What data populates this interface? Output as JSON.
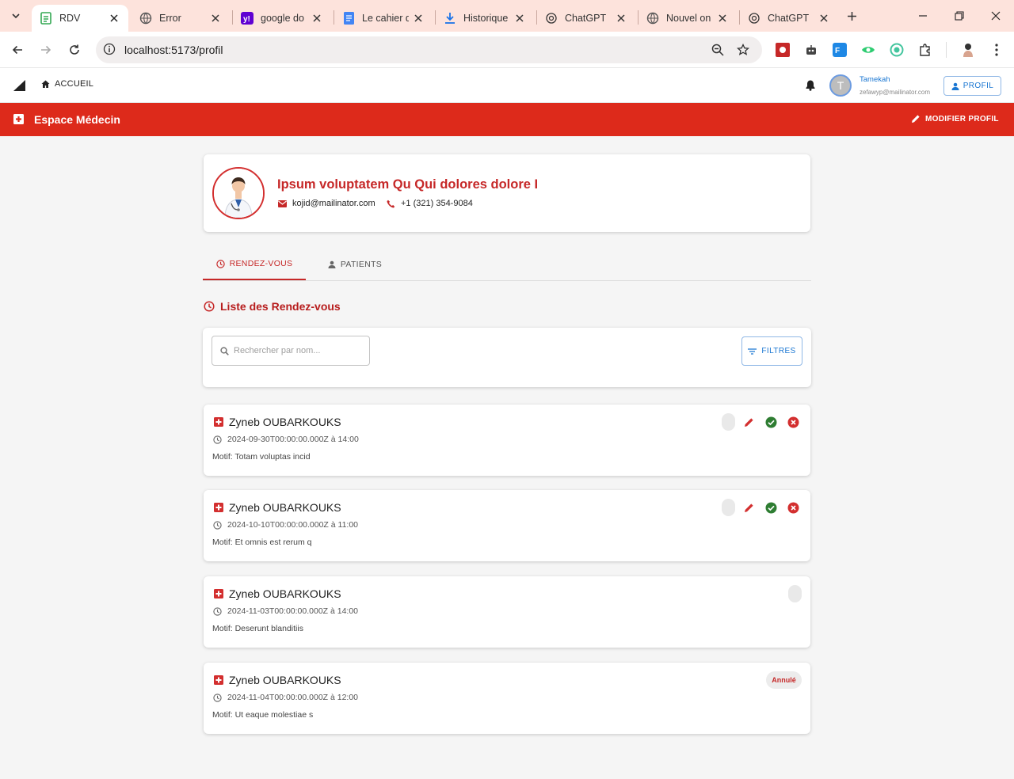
{
  "browser": {
    "tabs": [
      {
        "title": "RDV",
        "favicon": "rdv-doc-icon",
        "active": true
      },
      {
        "title": "Error",
        "favicon": "globe-icon"
      },
      {
        "title": "google do",
        "favicon": "yahoo-icon"
      },
      {
        "title": "Le cahier d",
        "favicon": "docs-icon"
      },
      {
        "title": "Historique",
        "favicon": "download-icon"
      },
      {
        "title": "ChatGPT",
        "favicon": "chatgpt-icon"
      },
      {
        "title": "Nouvel on",
        "favicon": "globe-icon"
      },
      {
        "title": "ChatGPT",
        "favicon": "chatgpt-icon"
      }
    ],
    "url": "localhost:5173/profil"
  },
  "appbar": {
    "home_label": "ACCUEIL",
    "user_initial": "T",
    "user_name": "Tamekah",
    "user_email": "zefawyp@mailinator.com",
    "profile_button": "PROFIL"
  },
  "banner": {
    "title": "Espace Médecin",
    "edit_button": "MODIFIER PROFIL",
    "color": "#dd2a1b"
  },
  "profile": {
    "name": "Ipsum voluptatem Qu Qui dolores dolore I",
    "email": "kojid@mailinator.com",
    "phone": "+1 (321) 354-9084"
  },
  "tabs": {
    "appointments": "RENDEZ-VOUS",
    "patients": "PATIENTS"
  },
  "list": {
    "title": "Liste des Rendez-vous",
    "search_placeholder": "Rechercher par nom...",
    "filter_button": "FILTRES"
  },
  "appointments": [
    {
      "patient": "Zyneb OUBARKOUKS",
      "date": "2024-09-30T00:00:00.000Z à 14:00",
      "motif": "Motif: Totam voluptas incid",
      "status": "pending",
      "actions": [
        "edit-icon",
        "confirm-icon",
        "cancel-icon"
      ]
    },
    {
      "patient": "Zyneb OUBARKOUKS",
      "date": "2024-10-10T00:00:00.000Z à 11:00",
      "motif": "Motif: Et omnis est rerum q",
      "status": "pending",
      "actions": [
        "edit-icon",
        "confirm-icon",
        "cancel-icon"
      ]
    },
    {
      "patient": "Zyneb OUBARKOUKS",
      "date": "2024-11-03T00:00:00.000Z à 14:00",
      "motif": "Motif: Deserunt blanditiis",
      "status": "unknown"
    },
    {
      "patient": "Zyneb OUBARKOUKS",
      "date": "2024-11-04T00:00:00.000Z à 12:00",
      "motif": "Motif: Ut eaque molestiae s",
      "status": "Annulé"
    }
  ],
  "colors": {
    "accent_red": "#c62828",
    "primary_blue": "#1976d2",
    "confirm_green": "#2e7d32",
    "tabstrip": "#fde3dc"
  }
}
